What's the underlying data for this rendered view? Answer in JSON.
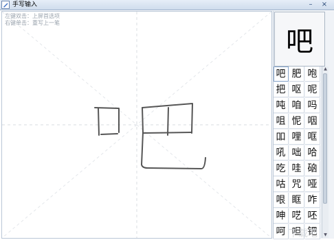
{
  "window": {
    "title": "手写输入",
    "minimize_label": "–",
    "close_label": "×"
  },
  "pad": {
    "hint_left": "左键双击：上屏首选项",
    "hint_right": "右键单击：重写上一笔"
  },
  "preview": {
    "char": "吧"
  },
  "candidates": [
    "吧",
    "肥",
    "咆",
    "把",
    "呕",
    "呢",
    "吨",
    "咱",
    "吗",
    "咀",
    "怩",
    "咽",
    "吅",
    "哩",
    "哐",
    "吼",
    "咄",
    "哈",
    "吃",
    "哇",
    "硇",
    "咕",
    "咒",
    "哑",
    "哏",
    "眶",
    "咋",
    "呻",
    "呓",
    "呸",
    "呵",
    "呾",
    "钯"
  ],
  "watermark": "下载吧"
}
